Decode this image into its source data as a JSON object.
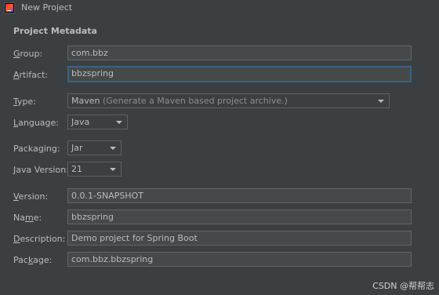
{
  "window": {
    "title": "New Project",
    "icon": "intellij-idea-icon"
  },
  "section": {
    "title": "Project Metadata"
  },
  "fields": {
    "group": {
      "mnemonic": "G",
      "rest": "roup:",
      "value": "com.bbz"
    },
    "artifact": {
      "mnemonic": "A",
      "rest": "rtifact:",
      "value": "bbzspring"
    },
    "type": {
      "mnemonic": "T",
      "rest": "ype:",
      "value": "Maven",
      "hint": "(Generate a Maven based project archive.)"
    },
    "language": {
      "pre": "",
      "mnemonic": "L",
      "rest": "anguage:",
      "value": "Java"
    },
    "packaging": {
      "pre": "Packa",
      "mnemonic": "g",
      "rest": "ing:",
      "value": "Jar"
    },
    "java_version": {
      "pre": "",
      "mnemonic": "J",
      "rest": "ava Version:",
      "value": "21"
    },
    "version": {
      "pre": "",
      "mnemonic": "V",
      "rest": "ersion:",
      "value": "0.0.1-SNAPSHOT"
    },
    "name": {
      "pre": "Na",
      "mnemonic": "m",
      "rest": "e:",
      "value": "bbzspring"
    },
    "description": {
      "pre": "",
      "mnemonic": "D",
      "rest": "escription:",
      "value": "Demo project for Spring Boot"
    },
    "package": {
      "pre": "Pac",
      "mnemonic": "k",
      "rest": "age:",
      "value": "com.bbz.bbzspring"
    }
  },
  "watermark": "CSDN @帮帮志",
  "colors": {
    "background": "#3c3f41",
    "field_bg": "#45494a",
    "focus_border": "#3d6185",
    "text": "#bbbbbb"
  }
}
